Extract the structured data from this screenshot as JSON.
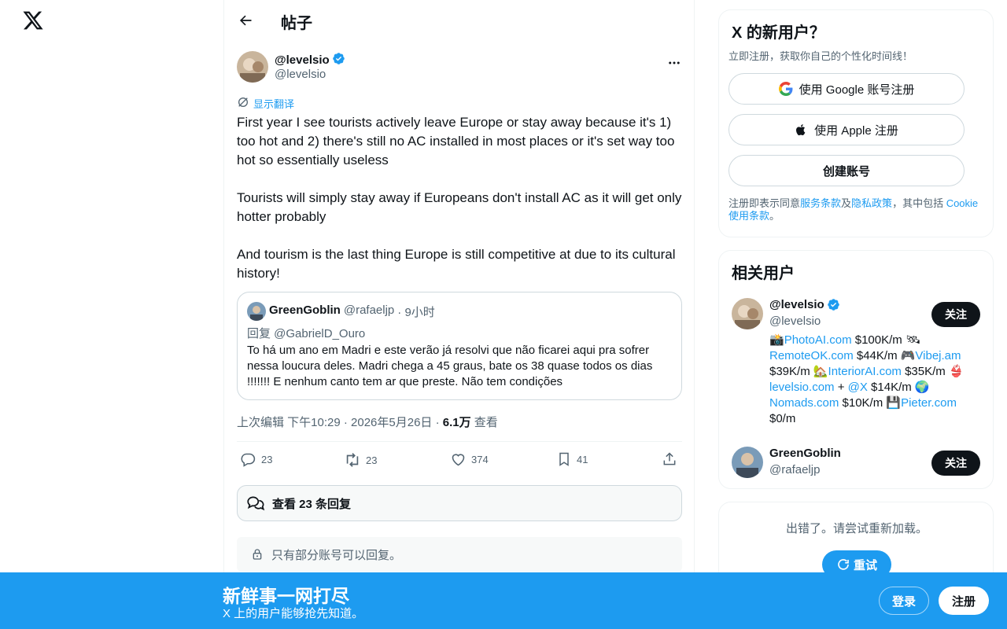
{
  "header": {
    "title": "帖子"
  },
  "post": {
    "author_name": "@levelsio",
    "author_handle": "@levelsio",
    "translate_label": "显示翻译",
    "paragraphs": [
      "First year I see tourists actively leave Europe or stay away because it's 1) too hot and 2) there's still no AC installed in most places or it's set way too hot so essentially useless",
      "Tourists will simply stay away if Europeans don't install AC as it will get only hotter probably",
      "And tourism is the last thing Europe is still competitive at due to its cultural history!"
    ],
    "quote": {
      "name": "GreenGoblin",
      "handle": "@rafaeljp",
      "time": "· 9小时",
      "reply_to": "回复 @GabrielD_Ouro",
      "text": "To há um ano em Madri e este verão já resolvi que não ficarei aqui pra sofrer nessa loucura deles. Madri chega a 45 graus, bate os 38 quase todos os dias !!!!!!! E nenhum canto tem ar que preste. Não tem condições"
    },
    "meta": {
      "edited": "上次编辑 下午10:29 · 2026年5月26日 ·",
      "views_count": "6.1万",
      "views_label": "查看"
    },
    "actions": {
      "replies": "23",
      "reposts": "23",
      "likes": "374",
      "bookmarks": "41"
    },
    "view_replies": "查看 23 条回复",
    "reply_limit": "只有部分账号可以回复。"
  },
  "signup": {
    "title": "X 的新用户？",
    "subtitle": "立即注册，获取你自己的个性化时间线！",
    "google": "使用 Google 账号注册",
    "apple": "使用 Apple 注册",
    "create": "创建账号",
    "terms_prefix": "注册即表示同意",
    "terms_link": "服务条款",
    "and": "及",
    "privacy_link": "隐私政策",
    "including": "，其中包括 ",
    "cookie_link": "Cookie 使用条款",
    "period": "。"
  },
  "related": {
    "title": "相关用户",
    "users": [
      {
        "name": "@levelsio",
        "handle": "@levelsio",
        "follow": "关注",
        "bio_parts": [
          "📸",
          "PhotoAI.com",
          " $100K/m 🛰 ",
          "RemoteOK.com",
          " $44K/m 🎮",
          "Vibej.am",
          " $39K/m 🏡",
          "InteriorAI.com",
          " $35K/m 👙 ",
          "levelsio.com",
          " + ",
          "@X",
          " $14K/m 🌍 ",
          "Nomads.com",
          " $10K/m 💾",
          "Pieter.com",
          " $0/m"
        ]
      },
      {
        "name": "GreenGoblin",
        "handle": "@rafaeljp",
        "follow": "关注"
      }
    ]
  },
  "error": {
    "text": "出错了。请尝试重新加载。",
    "retry": "重试"
  },
  "banner": {
    "title": "新鲜事一网打尽",
    "subtitle": "X 上的用户能够抢先知道。",
    "login": "登录",
    "signup": "注册"
  },
  "colors": {
    "accent": "#1d9bf0",
    "text": "#0f1419",
    "muted": "#536471",
    "border": "#cfd9de"
  }
}
